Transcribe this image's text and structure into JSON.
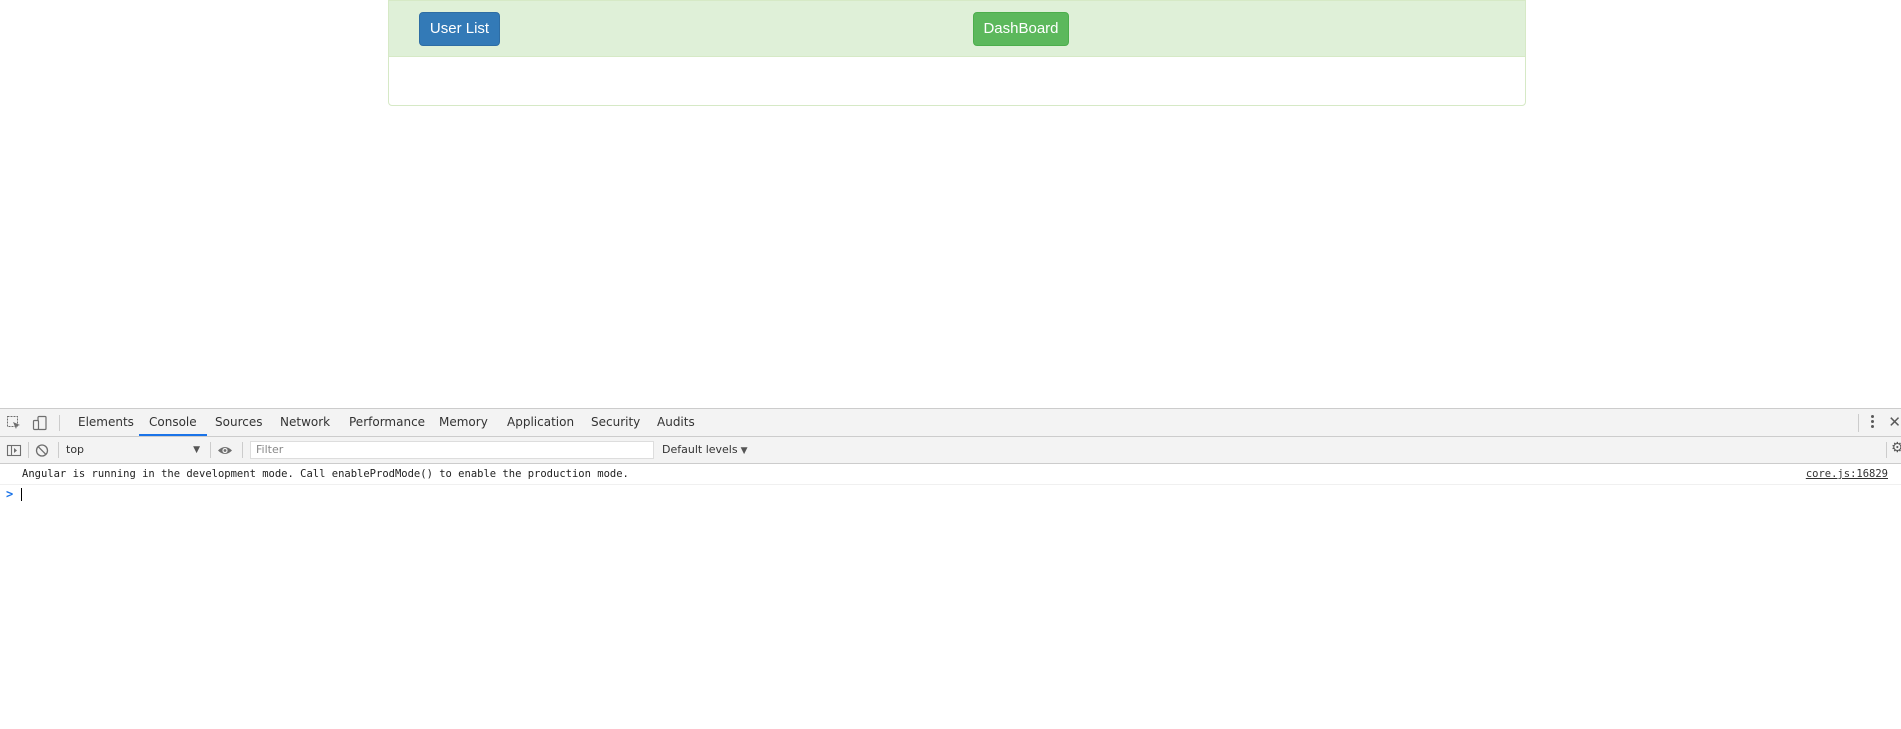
{
  "page": {
    "buttons": {
      "user_list": "User List",
      "dashboard": "DashBoard"
    }
  },
  "devtools": {
    "tabs": [
      "Elements",
      "Console",
      "Sources",
      "Network",
      "Performance",
      "Memory",
      "Application",
      "Security",
      "Audits"
    ],
    "active_tab": "Console",
    "toolbar": {
      "context": "top",
      "filter_placeholder": "Filter",
      "filter_value": "",
      "levels": "Default levels"
    },
    "console": {
      "messages": [
        {
          "text": "Angular is running in the development mode. Call enableProdMode() to enable the production mode.",
          "source": "core.js:16829"
        }
      ],
      "prompt": ">"
    },
    "icons": [
      "inspect-element-icon",
      "device-toolbar-icon",
      "sidebar-toggle-icon",
      "clear-console-icon",
      "eye-icon",
      "more-options-icon",
      "close-icon",
      "settings-gear-icon"
    ],
    "colors": {
      "accent": "#1a73e8",
      "toolbar_bg": "#f3f3f3"
    }
  },
  "colors": {
    "panel_header_bg": "#dff0d8",
    "panel_border": "#d6e9c6",
    "primary_button": "#337ab7",
    "success_button": "#5cb85c"
  }
}
